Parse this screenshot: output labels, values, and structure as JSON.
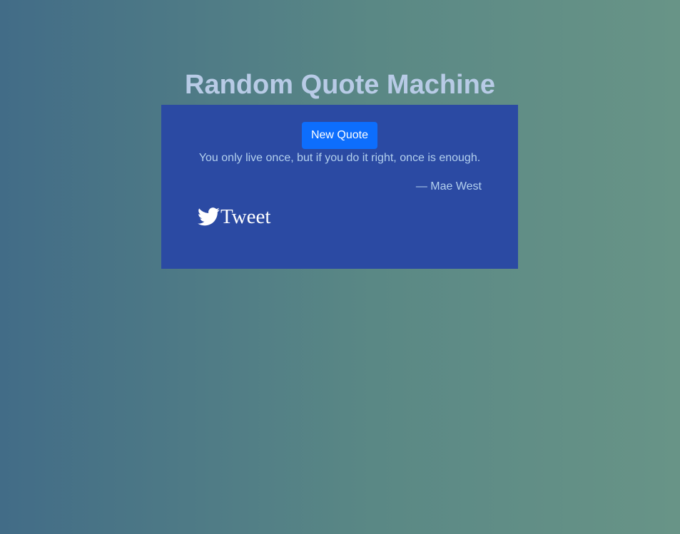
{
  "page": {
    "title": "Random Quote Machine"
  },
  "quote_box": {
    "new_quote_label": "New Quote",
    "quote_text": "You only live once, but if you do it right, once is enough.",
    "author": "— Mae West",
    "tweet_label": "Tweet",
    "tweet_icon": "twitter-bird-icon"
  },
  "colors": {
    "background_gradient_start": "#426c87",
    "background_gradient_end": "#689487",
    "title": "#b8cbe6",
    "quote_box_background": "#2b4aa3",
    "button_background": "#0d6efd",
    "quote_text": "#b3d0ee",
    "tweet": "#ffffff"
  }
}
